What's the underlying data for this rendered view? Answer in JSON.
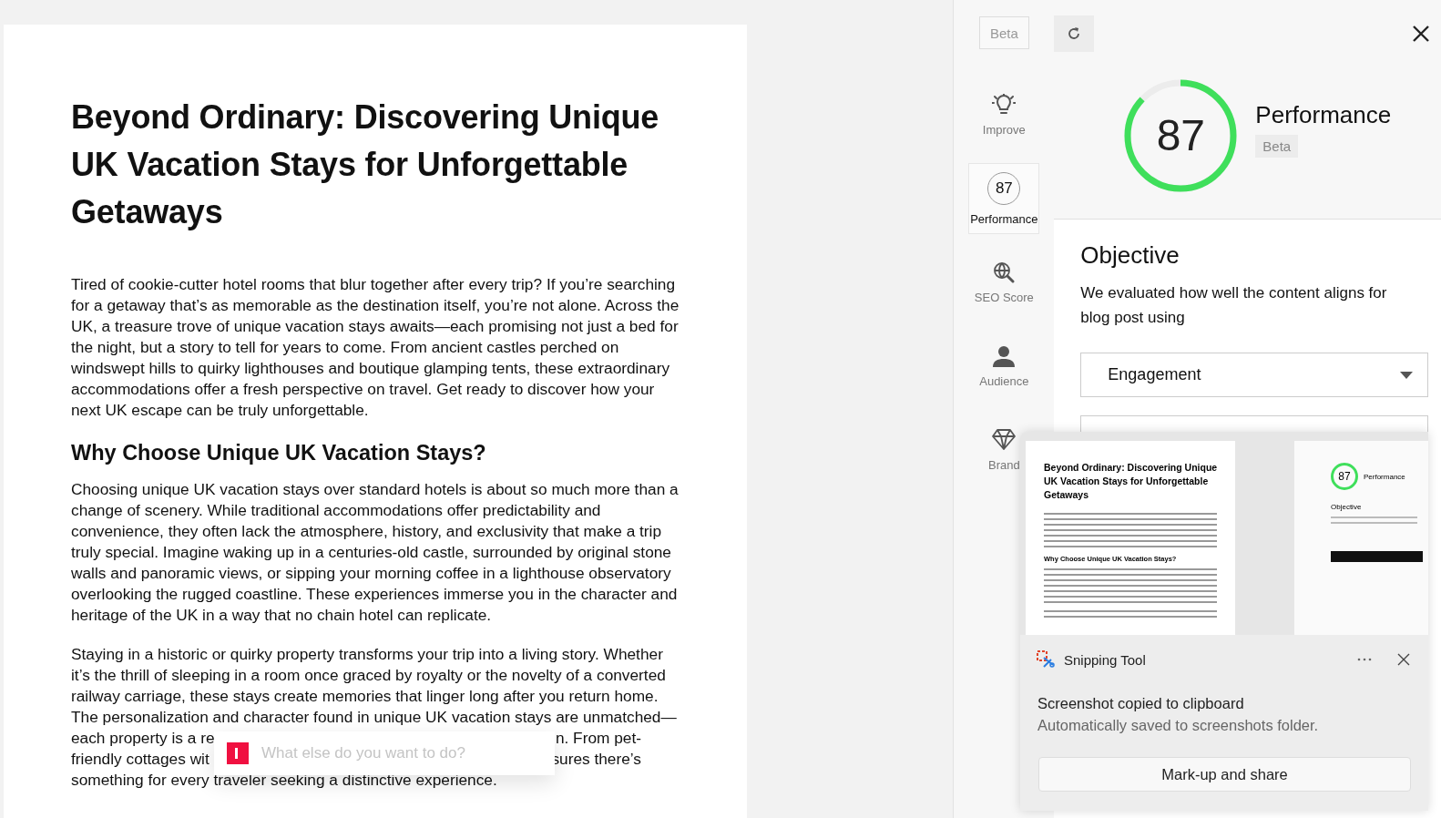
{
  "document": {
    "title": "Beyond Ordinary: Discovering Unique UK Vacation Stays for Unforgettable Getaways",
    "blocks": [
      {
        "kind": "paragraph",
        "text": "Tired of cookie-cutter hotel rooms that blur together after every trip? If you’re searching for a getaway that’s as memorable as the destination itself, you’re not alone. Across the UK, a treasure trove of unique vacation stays awaits—each promising not just a bed for the night, but a story to tell for years to come. From ancient castles perched on windswept hills to quirky lighthouses and boutique glamping tents, these extraordinary accommodations offer a fresh perspective on travel. Get ready to discover how your next UK escape can be truly unforgettable."
      },
      {
        "kind": "heading",
        "text": "Why Choose Unique UK Vacation Stays?"
      },
      {
        "kind": "paragraph",
        "text": "Choosing unique UK vacation stays over standard hotels is about so much more than a change of scenery. While traditional accommodations offer predictability and convenience, they often lack the atmosphere, history, and exclusivity that make a trip truly special. Imagine waking up in a centuries-old castle, surrounded by original stone walls and panoramic views, or sipping your morning coffee in a lighthouse observatory overlooking the rugged coastline. These experiences immerse you in the character and heritage of the UK in a way that no chain hotel can replicate."
      },
      {
        "kind": "lines",
        "lines": [
          {
            "text": "Staying in a historic or quirky property transforms your trip into a living story. Whether"
          },
          {
            "text": "it’s the thrill of sleeping in a room once graced by royalty or the novelty of a converted"
          },
          {
            "text": "railway carriage, these stays create memories that linger long after you return home."
          },
          {
            "text": "The personalization and character found in unique UK vacation stays are unmatched—"
          },
          {
            "left": "each property is a re",
            "right": "n. From pet-"
          },
          {
            "left": "friendly cottages wit",
            "right": "sures there’s"
          },
          {
            "text": "something for every traveler seeking a distinctive experience."
          }
        ]
      }
    ]
  },
  "prompt": {
    "placeholder": "What else do you want to do?"
  },
  "panel": {
    "beta": "Beta",
    "nav": [
      {
        "kind": "improve",
        "label": "Improve",
        "selected": false
      },
      {
        "kind": "score",
        "score": "87",
        "label": "Performance",
        "selected": true
      },
      {
        "kind": "seo",
        "label": "SEO Score",
        "selected": false
      },
      {
        "kind": "audience",
        "label": "Audience",
        "selected": false
      },
      {
        "kind": "brand",
        "label": "Brand",
        "selected": false
      }
    ],
    "score": {
      "value": "87",
      "level": 0.87,
      "title": "Performance",
      "badge": "Beta"
    },
    "objective": {
      "heading": "Objective",
      "text": "We evaluated how well the content aligns for blog post using",
      "dropdown": "Engagement"
    }
  },
  "toast": {
    "app": "Snipping Tool",
    "title": "Screenshot copied to clipboard",
    "message": "Automatically saved to screenshots folder.",
    "action": "Mark-up and share",
    "thumbnail": {
      "title": "Beyond Ordinary: Discovering Unique UK Vacation Stays for Unforgettable Getaways",
      "heading": "Why Choose Unique UK Vacation Stays?",
      "score": "87",
      "score_title": "Performance",
      "objective": "Objective"
    }
  }
}
